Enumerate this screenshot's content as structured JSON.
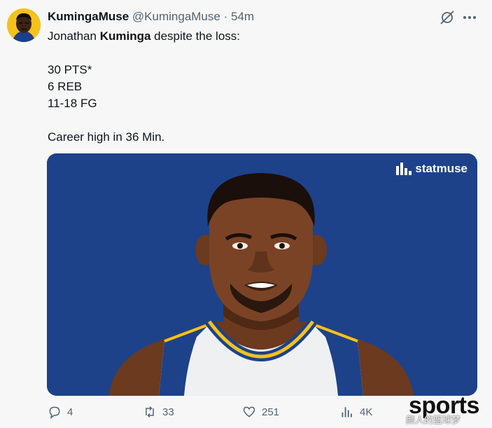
{
  "tweet": {
    "display_name": "KumingaMuse",
    "handle": "@KumingaMuse",
    "separator": "·",
    "time": "54m",
    "text_line1_pre": "Jonathan ",
    "text_line1_bold": "Kuminga",
    "text_line1_post": " despite the loss:",
    "text_line2": "30 PTS*",
    "text_line3": "6 REB",
    "text_line4": "11-18 FG",
    "text_line5": "Career high in 36 Min."
  },
  "media": {
    "brand": "statmuse",
    "background_color": "#1d428a"
  },
  "actions": {
    "replies": "4",
    "retweets": "33",
    "likes": "251",
    "views": "4K"
  },
  "watermark": {
    "title": "sports",
    "subtitle": "颜人的篮球梦"
  },
  "icons": [
    "grok-icon",
    "more-icon",
    "reply-icon",
    "retweet-icon",
    "like-icon",
    "views-icon"
  ]
}
